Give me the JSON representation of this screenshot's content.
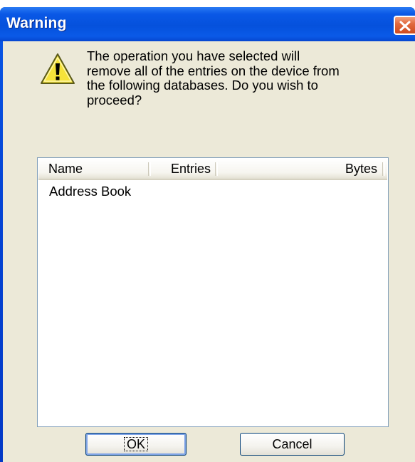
{
  "window": {
    "title": "Warning",
    "close_icon": "close-icon"
  },
  "dialog": {
    "icon": "warning-icon",
    "message": "The operation you have selected will\nremove all of the entries on the device from\nthe following databases.  Do you wish to\nproceed?"
  },
  "list": {
    "columns": {
      "name": "Name",
      "entries": "Entries",
      "bytes": "Bytes"
    },
    "rows": [
      {
        "name": "Address Book",
        "entries": "",
        "bytes": ""
      }
    ]
  },
  "buttons": {
    "ok_label": "OK",
    "cancel_label": "Cancel"
  },
  "colors": {
    "titlebar": "#0a58e6",
    "client_bg": "#ece9d8",
    "close_button": "#e06a3f",
    "warning_yellow": "#f5e23a"
  }
}
